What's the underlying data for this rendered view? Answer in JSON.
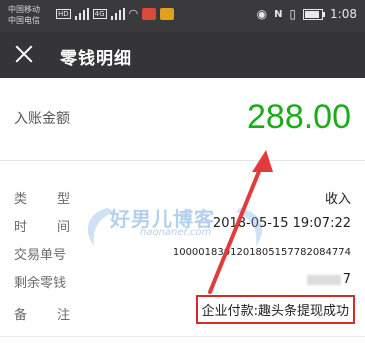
{
  "status_bar": {
    "carrier_1": "中国移动",
    "carrier_2": "中国电信",
    "hd_tag": "HD",
    "network_1": "4G",
    "network_2": "4G",
    "time": "1:08",
    "battery_level": 0.85
  },
  "navbar": {
    "title": "零钱明细"
  },
  "amount": {
    "label": "入账金额",
    "value": "288.00"
  },
  "details": {
    "type": {
      "label": "类型",
      "value": "收入"
    },
    "time": {
      "label": "时间",
      "value": "2018-05-15 19:07:22"
    },
    "trade_no": {
      "label": "交易单号",
      "value": "1000018301201805157782084774"
    },
    "balance": {
      "label": "剩余零钱",
      "value": "7"
    },
    "note": {
      "label": "备注",
      "value": "企业付款:趣头条提现成功"
    }
  },
  "watermark": {
    "title": "好男儿博客",
    "subtitle": "haonaner.com"
  },
  "colors": {
    "amount_green": "#1aad19",
    "highlight_red": "#d72a2a",
    "navbar_bg": "#353538"
  }
}
